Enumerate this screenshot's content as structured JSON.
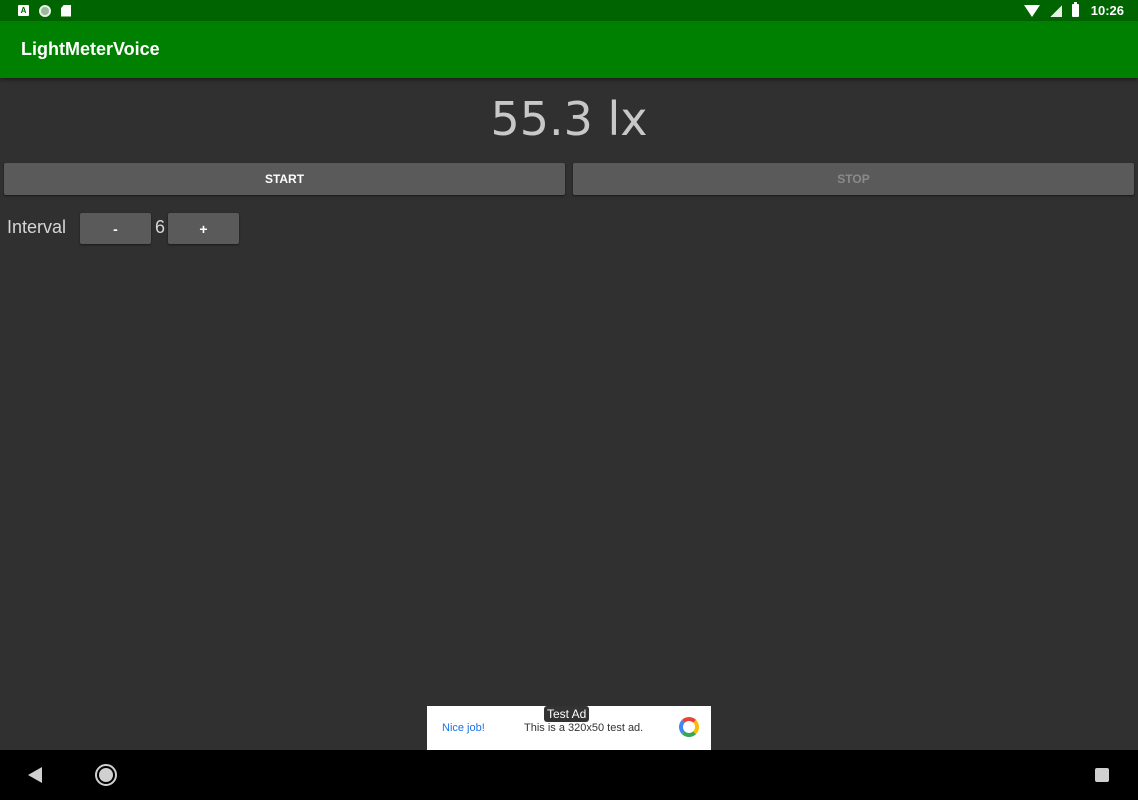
{
  "status_bar": {
    "time": "10:26",
    "left_icons": [
      "a-notification-icon",
      "circle-notification-icon",
      "sd-card-icon"
    ],
    "right_icons": [
      "wifi-icon",
      "signal-icon",
      "battery-icon"
    ]
  },
  "app_bar": {
    "title": "LightMeterVoice"
  },
  "reading": {
    "value": "55.3 lx"
  },
  "controls": {
    "start_label": "START",
    "stop_label": "STOP",
    "interval_label": "Interval",
    "minus_label": "-",
    "interval_value": "6",
    "plus_label": "+"
  },
  "ad": {
    "tag": "Test Ad",
    "headline": "Nice job!",
    "text": "This is a 320x50 test ad."
  },
  "colors": {
    "status_bar": "#006400",
    "app_bar": "#008000",
    "background": "#303030",
    "button": "#5a5a5a"
  },
  "nav_bar": {
    "icons": [
      "back-icon",
      "home-icon",
      "recents-icon"
    ]
  }
}
